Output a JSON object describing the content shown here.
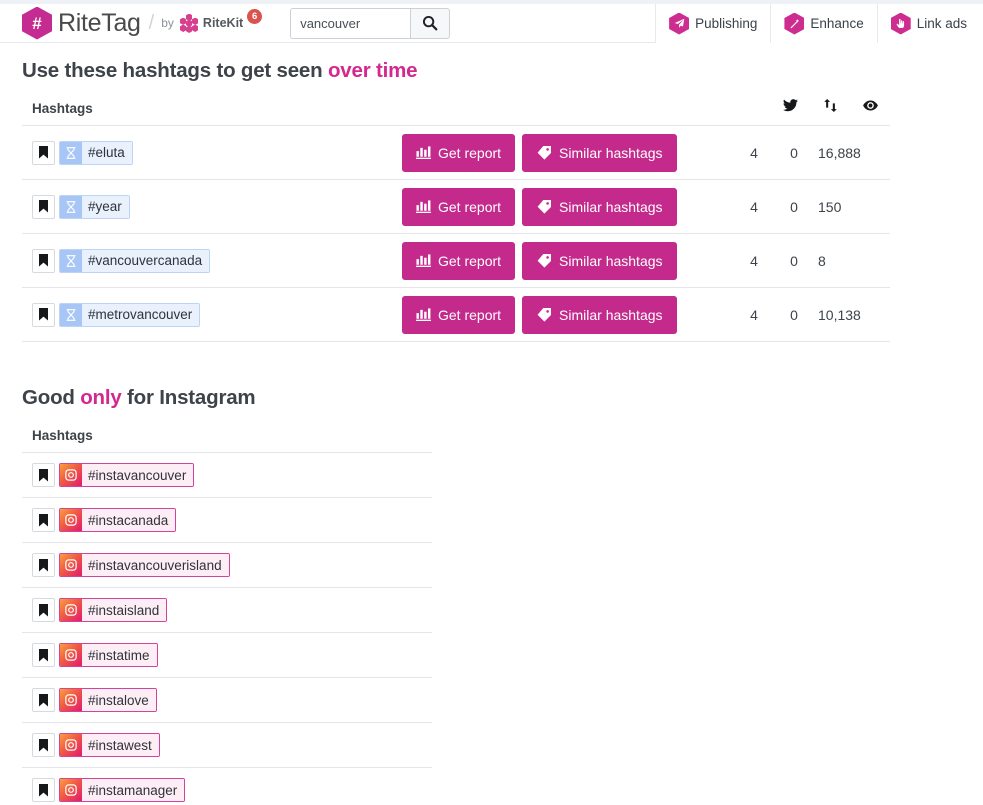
{
  "header": {
    "brand_name": "RiteTag",
    "brand_hash_glyph": "#",
    "separator": "/",
    "by_word": "by",
    "parent_brand": "RiteKit",
    "notification_count": "6",
    "nav": [
      {
        "label": "Publishing",
        "icon": "paper-plane-icon"
      },
      {
        "label": "Enhance",
        "icon": "magic-wand-icon"
      },
      {
        "label": "Link ads",
        "icon": "pointer-hand-icon"
      }
    ]
  },
  "search": {
    "value": "vancouver",
    "placeholder": "",
    "button_icon": "search-icon"
  },
  "colors": {
    "brand_magenta": "#c42c92",
    "accent_pink": "#d5288f",
    "button_magenta": "#c32a8c",
    "badge_red": "#d9534f",
    "twitter_chip_bg": "#e9f1fd",
    "twitter_chip_icon_bg": "#a8c6f5",
    "instagram_chip_bg": "#fdeef6",
    "instagram_chip_border": "#d0449b"
  },
  "section_over_time": {
    "title_prefix": "Use these hashtags to get seen ",
    "title_accent": "over time",
    "column_hashtags": "Hashtags",
    "column_icons": [
      "twitter-bird-icon",
      "retweet-icon",
      "eye-icon"
    ],
    "actions": {
      "get_report": "Get report",
      "similar_hashtags": "Similar hashtags"
    },
    "rows": [
      {
        "hashtag": "#eluta",
        "tweets": "4",
        "retweets": "0",
        "views": "16,888"
      },
      {
        "hashtag": "#year",
        "tweets": "4",
        "retweets": "0",
        "views": "150"
      },
      {
        "hashtag": "#vancouvercanada",
        "tweets": "4",
        "retweets": "0",
        "views": "8"
      },
      {
        "hashtag": "#metrovancouver",
        "tweets": "4",
        "retweets": "0",
        "views": "10,138"
      }
    ]
  },
  "section_instagram": {
    "title_prefix": "Good ",
    "title_accent": "only",
    "title_suffix": " for Instagram",
    "column_hashtags": "Hashtags",
    "rows": [
      {
        "hashtag": "#instavancouver"
      },
      {
        "hashtag": "#instacanada"
      },
      {
        "hashtag": "#instavancouverisland"
      },
      {
        "hashtag": "#instaisland"
      },
      {
        "hashtag": "#instatime"
      },
      {
        "hashtag": "#instalove"
      },
      {
        "hashtag": "#instawest"
      },
      {
        "hashtag": "#instamanager"
      }
    ]
  }
}
